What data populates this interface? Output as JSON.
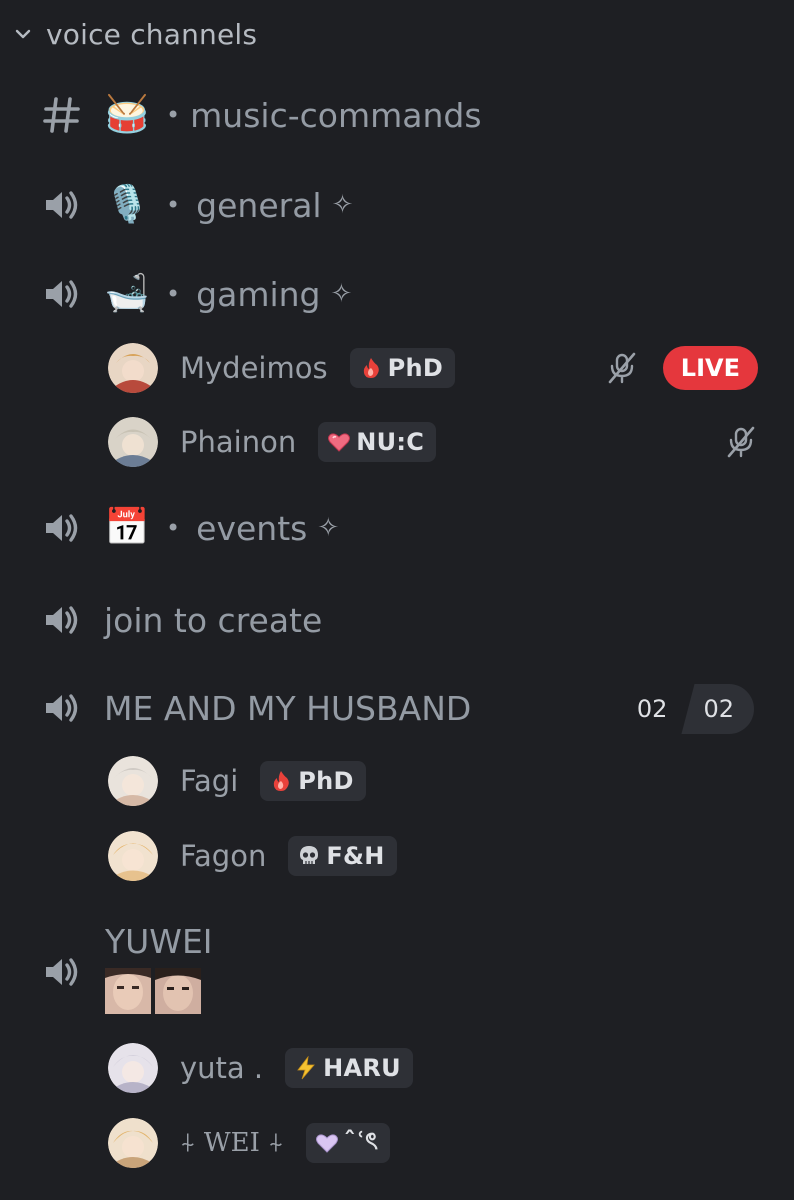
{
  "category": {
    "title": "voice channels",
    "collapse_icon": "chevron-down-icon"
  },
  "channels": [
    {
      "type": "text",
      "icon": "hash-icon",
      "emoji": "🥁",
      "separator": "•",
      "name": "music-commands",
      "suffix": ""
    },
    {
      "type": "voice",
      "icon": "speaker-icon",
      "emoji": "🎙️",
      "separator": "•",
      "name": "general",
      "suffix": "✧"
    },
    {
      "type": "voice",
      "icon": "speaker-icon",
      "emoji": "🛁",
      "separator": "•",
      "name": "gaming",
      "suffix": "✧"
    },
    {
      "type": "voice",
      "icon": "speaker-icon",
      "emoji": "📅",
      "separator": "•",
      "name": "events",
      "suffix": "✧"
    },
    {
      "type": "voice",
      "icon": "speaker-icon",
      "name": "join to create"
    },
    {
      "type": "voice",
      "icon": "speaker-icon",
      "name": "ME AND MY HUSBAND",
      "user_count": "02",
      "user_limit": "02"
    },
    {
      "type": "voice",
      "icon": "speaker-icon",
      "name": "YUWEI"
    }
  ],
  "gaming_members": [
    {
      "name": "Mydeimos",
      "tag_icon": "fire-icon",
      "tag": "PhD",
      "muted": true,
      "live_label": "LIVE"
    },
    {
      "name": "Phainon",
      "tag_icon": "heart-icon",
      "tag": "NU:C",
      "muted": true
    }
  ],
  "husband_members": [
    {
      "name": "Fagi",
      "tag_icon": "fire-icon",
      "tag": "PhD"
    },
    {
      "name": "Fagon",
      "tag_icon": "skull-icon",
      "tag": "F&H"
    }
  ],
  "yuwei_members": [
    {
      "name": "yuta .",
      "tag_icon": "lightning-icon",
      "tag": "HARU"
    },
    {
      "name": "⍭ WEI ⍭",
      "tag_icon": "lavender-heart-icon",
      "tag": "ˆʿৎ"
    }
  ],
  "colors": {
    "background": "#1e1f23",
    "text_muted": "#949ba4",
    "tag_bg": "#2e3036",
    "live_red": "#e5373d"
  }
}
